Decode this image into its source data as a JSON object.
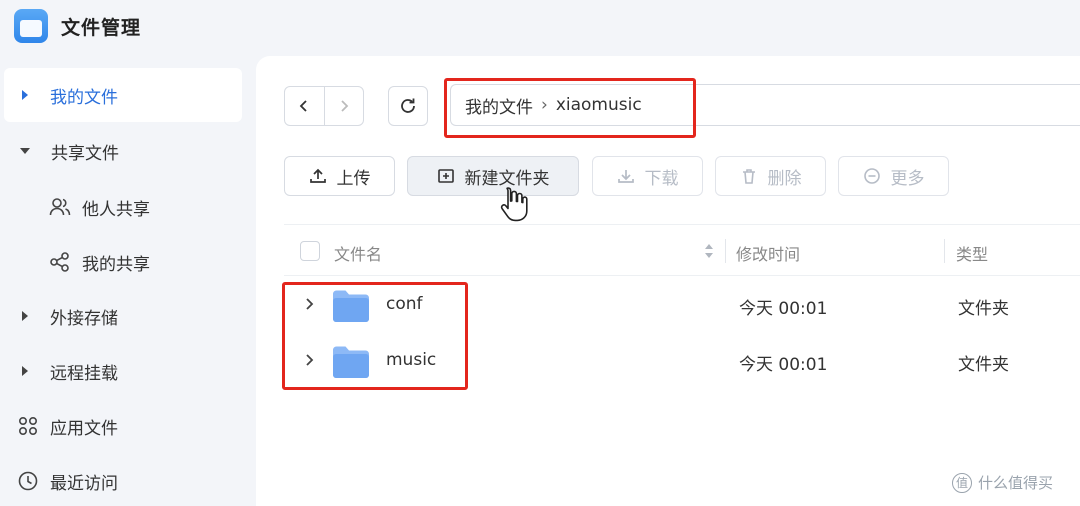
{
  "app": {
    "title": "文件管理",
    "accent": "#2a6fdb"
  },
  "sidebar": {
    "items": [
      {
        "label": "我的文件",
        "icon": "caret-right-icon",
        "active": true
      },
      {
        "label": "共享文件",
        "icon": "caret-down-icon"
      },
      {
        "label": "他人共享",
        "icon": "users-icon"
      },
      {
        "label": "我的共享",
        "icon": "share-icon"
      },
      {
        "label": "外接存储",
        "icon": "caret-right-icon"
      },
      {
        "label": "远程挂载",
        "icon": "caret-right-icon"
      },
      {
        "label": "应用文件",
        "icon": "apps-icon"
      },
      {
        "label": "最近访问",
        "icon": "clock-icon"
      }
    ]
  },
  "path": {
    "root": "我的文件",
    "current": "xiaomusic"
  },
  "toolbar": {
    "upload": "上传",
    "new_folder": "新建文件夹",
    "download": "下载",
    "delete": "删除",
    "more": "更多"
  },
  "table": {
    "columns": {
      "name": "文件名",
      "modified": "修改时间",
      "type": "类型"
    },
    "rows": [
      {
        "name": "conf",
        "modified": "今天 00:01",
        "type": "文件夹"
      },
      {
        "name": "music",
        "modified": "今天 00:01",
        "type": "文件夹"
      }
    ]
  },
  "watermark": {
    "icon_glyph": "值",
    "text": "什么值得买"
  },
  "colors": {
    "highlight": "#e3261d",
    "folder": "#7fb0f5"
  }
}
